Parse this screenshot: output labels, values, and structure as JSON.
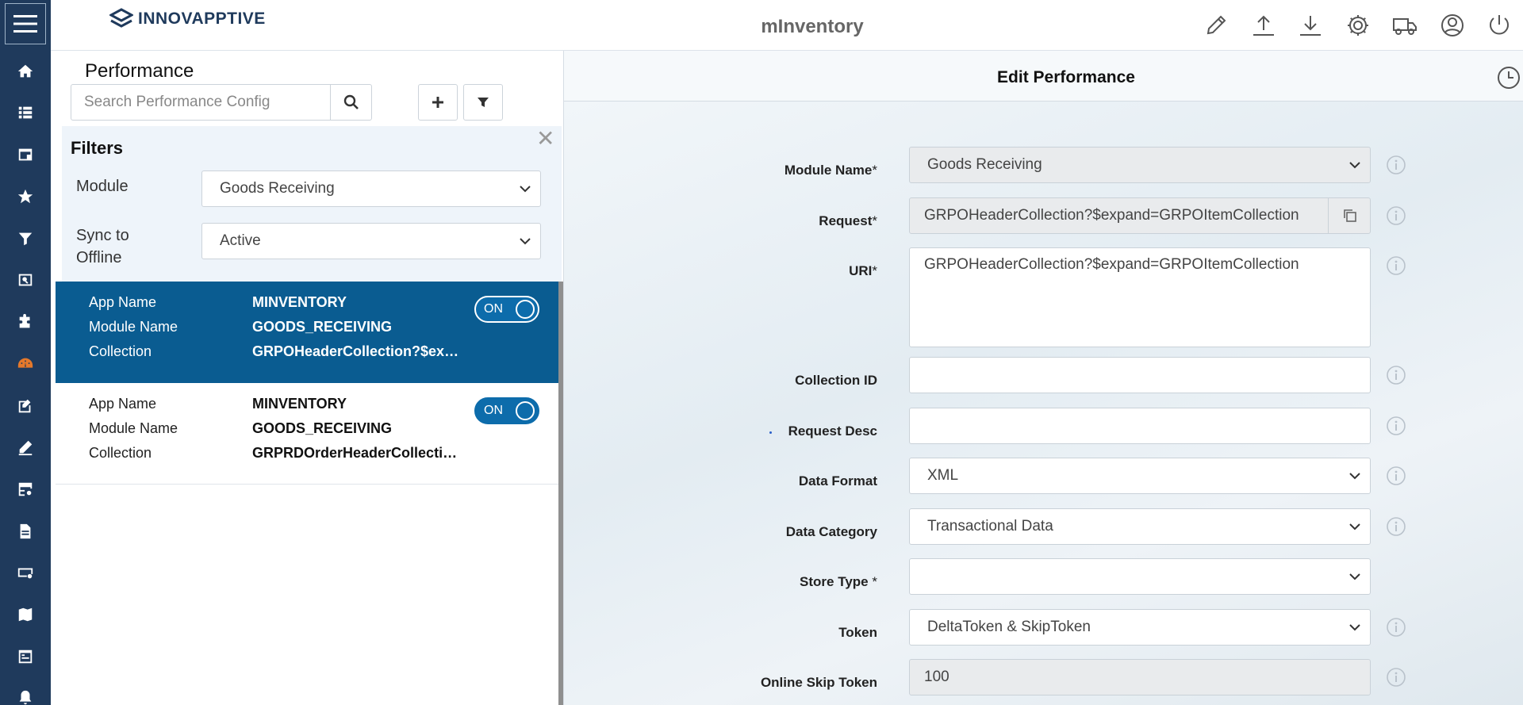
{
  "header": {
    "logo_text": "INNOVAPPTIVE",
    "app_title": "mInventory"
  },
  "left_panel": {
    "title": "Performance",
    "search_placeholder": "Search Performance Config",
    "filters": {
      "title": "Filters",
      "close_glyph": "✕",
      "module_label": "Module",
      "module_value": "Goods Receiving",
      "sync_label_line1": "Sync to",
      "sync_label_line2": "Offline",
      "sync_value": "Active"
    },
    "items": [
      {
        "app_name_label": "App Name",
        "app_name": "MINVENTORY",
        "module_name_label": "Module Name",
        "module_name": "GOODS_RECEIVING",
        "collection_label": "Collection",
        "collection": "GRPOHeaderCollection?$expand=GRPOItemCollection",
        "toggle_label": "ON"
      },
      {
        "app_name_label": "App Name",
        "app_name": "MINVENTORY",
        "module_name_label": "Module Name",
        "module_name": "GOODS_RECEIVING",
        "collection_label": "Collection",
        "collection": "GRPRDOrderHeaderCollection",
        "toggle_label": "ON"
      }
    ]
  },
  "form": {
    "title": "Edit Performance",
    "module_name_label": "Module Name",
    "module_name_value": "Goods Receiving",
    "request_label": "Request",
    "request_value": "GRPOHeaderCollection?$expand=GRPOItemCollection",
    "uri_label": "URI",
    "uri_value": "GRPOHeaderCollection?$expand=GRPOItemCollection",
    "collection_id_label": "Collection ID",
    "collection_id_value": "",
    "request_desc_label": "Request Desc",
    "request_desc_value": "",
    "data_format_label": "Data Format",
    "data_format_value": "XML",
    "data_category_label": "Data Category",
    "data_category_value": "Transactional Data",
    "store_type_label": "Store Type",
    "store_type_value": "",
    "token_label": "Token",
    "token_value": "DeltaToken & SkipToken",
    "online_skip_token_label": "Online Skip Token",
    "online_skip_token_value": "100",
    "required_mark": "*"
  },
  "colors": {
    "rail": "#1f3a5c",
    "accent_blue": "#0a5c91",
    "active_nav": "#e4782b"
  }
}
